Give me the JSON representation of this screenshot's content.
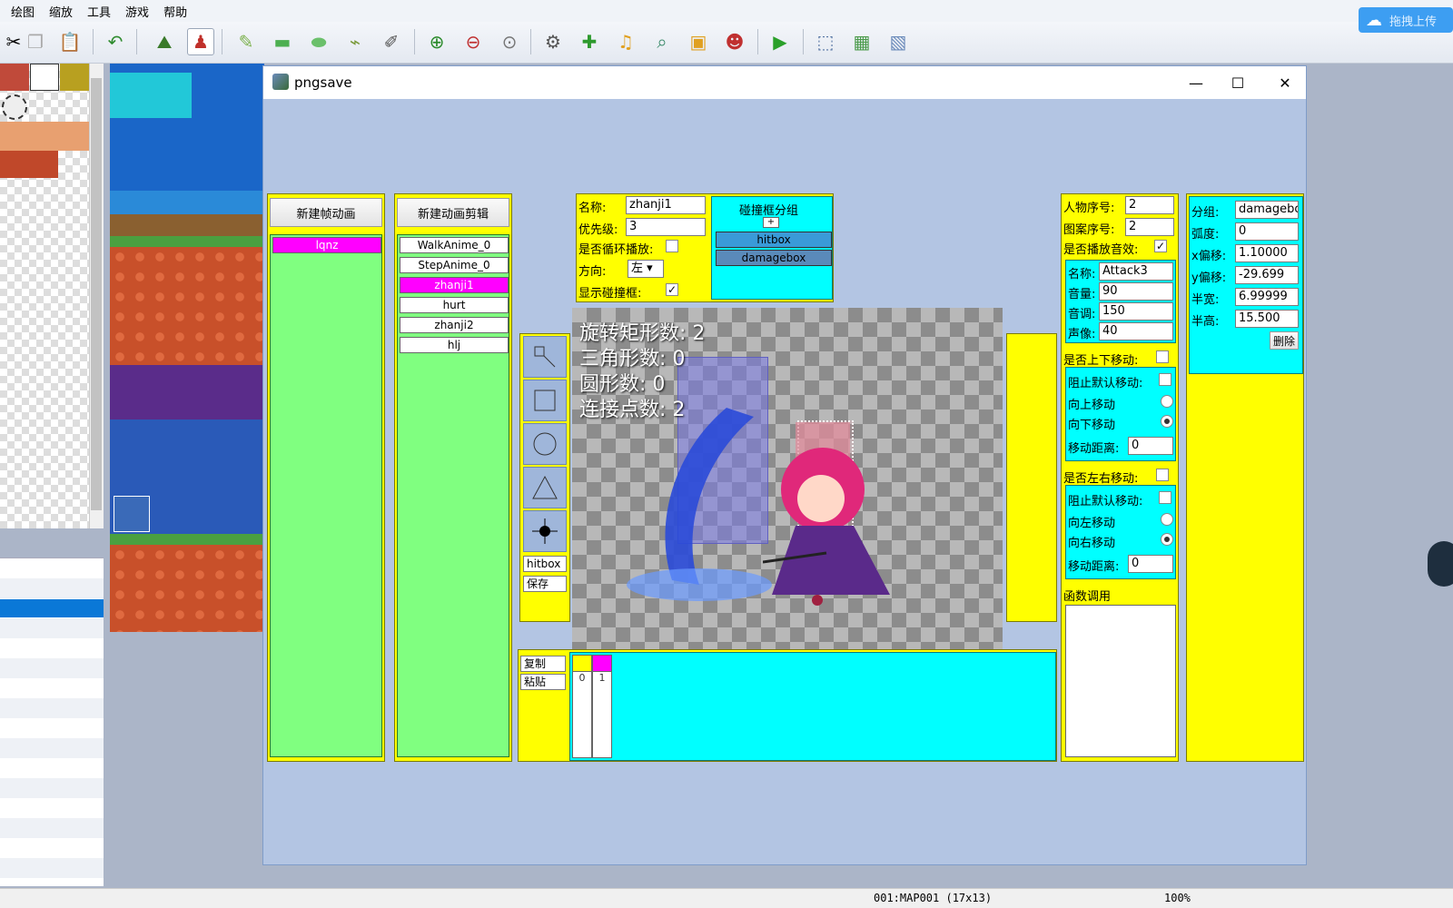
{
  "menu": [
    "绘图",
    "缩放",
    "工具",
    "游戏",
    "帮助"
  ],
  "cloud_label": "拖拽上传",
  "status": {
    "map": "001:MAP001 (17x13)",
    "zoom": "100%"
  },
  "window": {
    "title": "pngsave",
    "min": "—",
    "max": "☐",
    "close": "✕"
  },
  "frame_panel": {
    "button": "新建帧动画",
    "items": [
      "lqnz"
    ]
  },
  "clip_panel": {
    "button": "新建动画剪辑",
    "items": [
      "WalkAnime_0",
      "StepAnime_0",
      "zhanji1",
      "hurt",
      "zhanji2",
      "hlj"
    ]
  },
  "props": {
    "name_label": "名称:",
    "name_value": "zhanji1",
    "priority_label": "优先级:",
    "priority_value": "3",
    "loop_label": "是否循环播放:",
    "loop": false,
    "direction_label": "方向:",
    "direction_value": "左",
    "show_hitbox_label": "显示碰撞框:",
    "show_hitbox": true
  },
  "hitbox_groups": {
    "title": "碰撞框分组",
    "add": "+",
    "items": [
      "hitbox",
      "damagebox"
    ]
  },
  "tools": {
    "current": "hitbox",
    "save": "保存"
  },
  "canvas_stats": {
    "rect": "旋转矩形数: 2",
    "tri": "三角形数: 0",
    "circle": "圆形数: 0",
    "joint": "连接点数: 2"
  },
  "timeline": {
    "copy": "复制",
    "paste": "粘贴",
    "frames": [
      "0",
      "1"
    ]
  },
  "character": {
    "char_index_label": "人物序号:",
    "char_index": "2",
    "pattern_index_label": "图案序号:",
    "pattern_index": "2",
    "play_sound_label": "是否播放音效:",
    "play_sound": true,
    "sound": {
      "name_label": "名称:",
      "name": "Attack3",
      "volume_label": "音量:",
      "volume": "90",
      "pitch_label": "音调:",
      "pitch": "150",
      "pan_label": "声像:",
      "pan": "40"
    },
    "vmove_label": "是否上下移动:",
    "vmove": {
      "block_label": "阻止默认移动:",
      "up_label": "向上移动",
      "down_label": "向下移动",
      "dist_label": "移动距离:",
      "dist": "0"
    },
    "hmove_label": "是否左右移动:",
    "hmove": {
      "block_label": "阻止默认移动:",
      "left_label": "向左移动",
      "right_label": "向右移动",
      "dist_label": "移动距离:",
      "dist": "0"
    },
    "func_label": "函数调用"
  },
  "shape": {
    "group_label": "分组:",
    "group": "damagebox",
    "angle_label": "弧度:",
    "angle": "0",
    "x_label": "x偏移:",
    "x": "1.10000",
    "y_label": "y偏移:",
    "y": "-29.699",
    "w_label": "半宽:",
    "w": "6.99999",
    "h_label": "半高:",
    "h": "15.500",
    "delete": "删除"
  },
  "colors": {
    "panel": "#ffff00",
    "list": "#80ff80",
    "cyan": "#00ffff",
    "highlight": "#ff00ff"
  }
}
